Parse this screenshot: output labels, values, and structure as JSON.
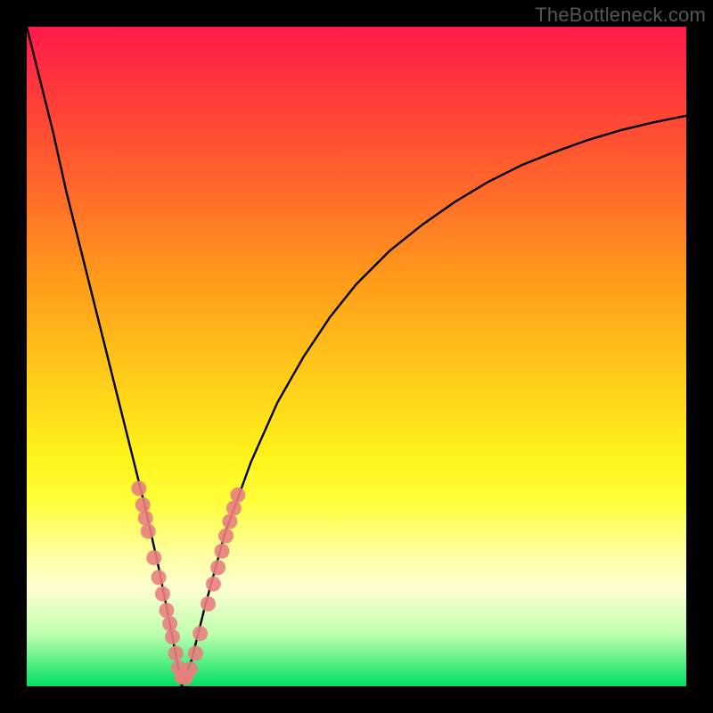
{
  "watermark": "TheBottleneck.com",
  "chart_data": {
    "type": "line",
    "title": "",
    "xlabel": "",
    "ylabel": "",
    "xlim": [
      0,
      100
    ],
    "ylim": [
      0,
      100
    ],
    "grid": false,
    "legend": false,
    "series": [
      {
        "name": "bottleneck-curve",
        "x": [
          0,
          2,
          4,
          6,
          8,
          10,
          12,
          14,
          16,
          18,
          20,
          22,
          23.5,
          25,
          27,
          30,
          34,
          38,
          42,
          46,
          50,
          55,
          60,
          65,
          70,
          75,
          80,
          85,
          90,
          95,
          100
        ],
        "y": [
          100,
          92,
          84,
          75,
          67,
          59,
          51,
          43,
          35,
          27,
          18,
          8,
          0,
          4,
          12,
          23,
          34,
          43,
          50,
          56,
          61,
          66,
          70,
          73.5,
          76.5,
          79,
          81,
          82.8,
          84.3,
          85.5,
          86.5
        ]
      }
    ],
    "beads": {
      "name": "highlight-beads",
      "points": [
        {
          "x": 17.0,
          "y": 30
        },
        {
          "x": 17.6,
          "y": 27.5
        },
        {
          "x": 18.0,
          "y": 25.5
        },
        {
          "x": 18.4,
          "y": 23.5
        },
        {
          "x": 19.3,
          "y": 19.5
        },
        {
          "x": 20.0,
          "y": 16.5
        },
        {
          "x": 20.6,
          "y": 14.0
        },
        {
          "x": 21.2,
          "y": 11.5
        },
        {
          "x": 21.7,
          "y": 9.5
        },
        {
          "x": 22.1,
          "y": 7.5
        },
        {
          "x": 22.6,
          "y": 5.0
        },
        {
          "x": 23.0,
          "y": 2.8
        },
        {
          "x": 23.5,
          "y": 1.4
        },
        {
          "x": 24.1,
          "y": 1.3
        },
        {
          "x": 24.8,
          "y": 2.6
        },
        {
          "x": 25.6,
          "y": 5.0
        },
        {
          "x": 26.3,
          "y": 8.0
        },
        {
          "x": 27.5,
          "y": 12.5
        },
        {
          "x": 28.3,
          "y": 15.5
        },
        {
          "x": 29.0,
          "y": 18.0
        },
        {
          "x": 29.6,
          "y": 20.5
        },
        {
          "x": 30.2,
          "y": 22.8
        },
        {
          "x": 30.8,
          "y": 25.0
        },
        {
          "x": 31.4,
          "y": 27.0
        },
        {
          "x": 32.0,
          "y": 29.0
        }
      ]
    },
    "gradient_stops": [
      {
        "pos": 0,
        "color": "#ff1a4a"
      },
      {
        "pos": 55,
        "color": "#ffd21a"
      },
      {
        "pos": 85,
        "color": "#ffffd0"
      },
      {
        "pos": 100,
        "color": "#00e060"
      }
    ]
  }
}
